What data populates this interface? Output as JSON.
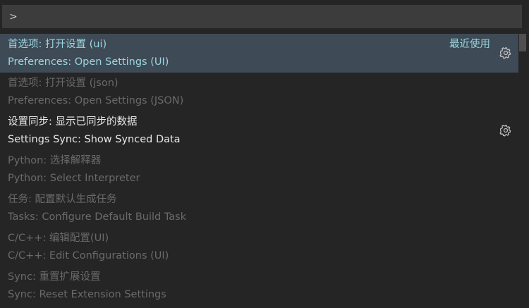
{
  "search": {
    "value": ">",
    "placeholder": ""
  },
  "items": [
    {
      "label": "首选项: 打开设置 (ui)",
      "detail": "Preferences: Open Settings (UI)",
      "badge": "最近使用",
      "state": "selected",
      "gear": true
    },
    {
      "label": "首选项: 打开设置 (json)",
      "detail": "Preferences: Open Settings (JSON)",
      "state": "dim",
      "gear": false
    },
    {
      "label": "设置同步: 显示已同步的数据",
      "detail": "Settings Sync: Show Synced Data",
      "state": "bright",
      "gear": true
    },
    {
      "label": "Python: 选择解释器",
      "detail": "Python: Select Interpreter",
      "state": "dim",
      "gear": false
    },
    {
      "label": "任务: 配置默认生成任务",
      "detail": "Tasks: Configure Default Build Task",
      "state": "dim",
      "gear": false
    },
    {
      "label": "C/C++: 编辑配置(UI)",
      "detail": "C/C++: Edit Configurations (UI)",
      "state": "dim",
      "gear": false
    },
    {
      "label": "Sync: 重置扩展设置",
      "detail": "Sync: Reset Extension Settings",
      "state": "dim",
      "gear": false
    }
  ],
  "icons": {
    "gear": "gear-icon"
  },
  "colors": {
    "background": "#252526",
    "input": "#3c3c3c",
    "selected_row": "#3e4a55",
    "selected_text": "#9ad7e0",
    "dim_text": "#6a6a6a",
    "bright_text": "#e8e8e8"
  }
}
